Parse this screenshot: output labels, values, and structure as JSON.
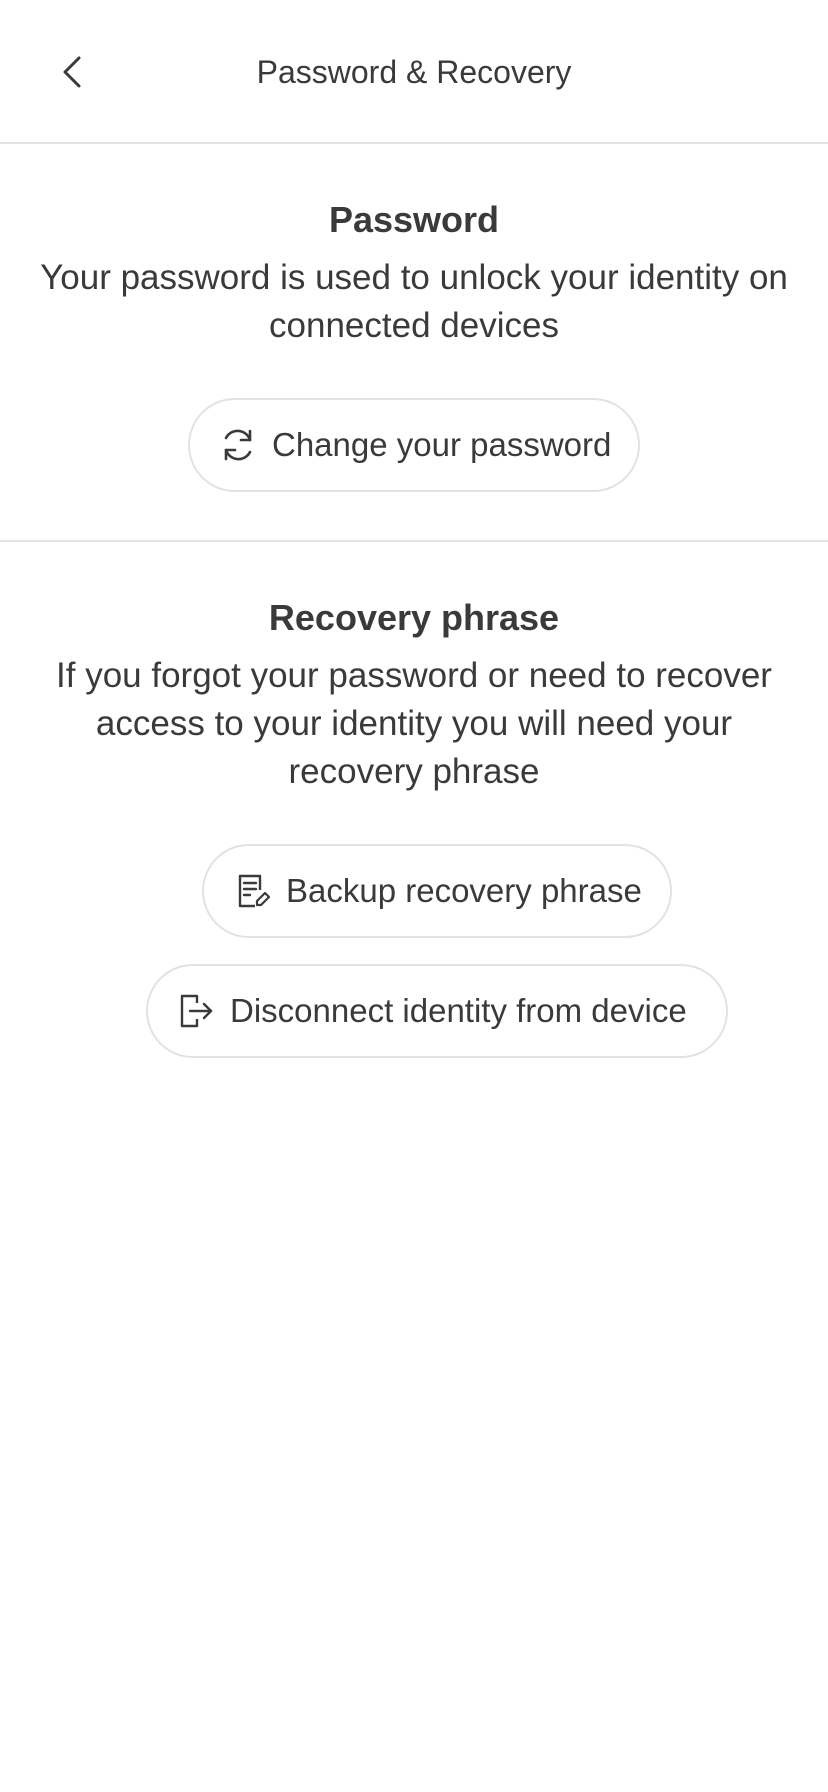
{
  "header": {
    "back_icon": "chevron-left-icon",
    "title": "Password & Recovery"
  },
  "password_section": {
    "title": "Password",
    "description": "Your password is used to unlock your identity on connected devices",
    "change_button": {
      "icon": "refresh-icon",
      "label": "Change your password"
    }
  },
  "recovery_section": {
    "title": "Recovery phrase",
    "description": "If you forgot your password or need to recover access to your identity you will need your recovery phrase",
    "backup_button": {
      "icon": "document-edit-icon",
      "label": "Backup recovery phrase"
    },
    "disconnect_button": {
      "icon": "logout-icon",
      "label": "Disconnect identity from device"
    }
  },
  "colors": {
    "text": "#3a3a3a",
    "divider": "#e4e4e4",
    "button_border": "#e2e2e2",
    "background": "#ffffff"
  }
}
